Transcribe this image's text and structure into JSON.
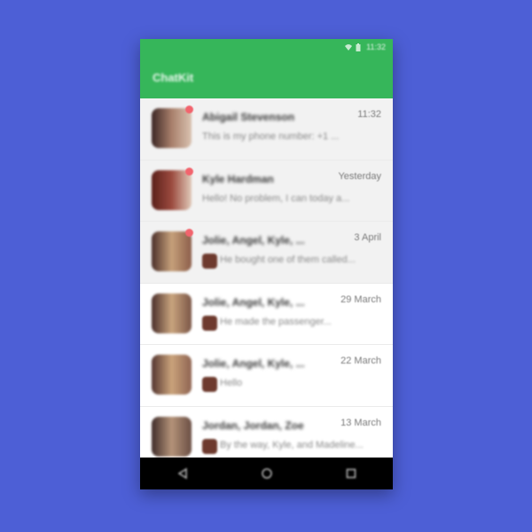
{
  "status_bar": {
    "time": "11:32"
  },
  "app_bar": {
    "title": "ChatKit"
  },
  "conversations": [
    {
      "name": "Abigail Stevenson",
      "time": "11:32",
      "snippet": "This is my phone number: +1 ...",
      "unread": true,
      "has_mini_avatar": false,
      "avatar_colors": [
        "#3b2624",
        "#a87f6b",
        "#d9c2b0"
      ]
    },
    {
      "name": "Kyle Hardman",
      "time": "Yesterday",
      "snippet": "Hello! No problem, I can today a...",
      "unread": true,
      "has_mini_avatar": false,
      "avatar_colors": [
        "#5a1f1a",
        "#9b4a3e",
        "#e0c9b8"
      ]
    },
    {
      "name": "Jolie, Angel, Kyle, ...",
      "time": "3 April",
      "snippet": "He bought one of them called...",
      "unread": true,
      "has_mini_avatar": true,
      "avatar_colors": [
        "#4b2f2a",
        "#c6a07a",
        "#8c5e4a"
      ]
    },
    {
      "name": "Jolie, Angel, Kyle, ...",
      "time": "29 March",
      "snippet": "He made the passenger...",
      "unread": false,
      "has_mini_avatar": true,
      "avatar_colors": [
        "#4a2e2b",
        "#c9a47e",
        "#7b5647"
      ]
    },
    {
      "name": "Jolie, Angel, Kyle, ...",
      "time": "22 March",
      "snippet": "Hello",
      "unread": false,
      "has_mini_avatar": true,
      "avatar_colors": [
        "#543530",
        "#caa37b",
        "#8f6452"
      ]
    },
    {
      "name": "Jordan, Jordan, Zoe",
      "time": "13 March",
      "snippet": "By the way, Kyle, and Madeline...",
      "unread": false,
      "has_mini_avatar": true,
      "avatar_colors": [
        "#3f2c2a",
        "#b49379",
        "#6a4e44"
      ]
    }
  ],
  "colors": {
    "background": "#4d5fd6",
    "app_bar": "#36b65a",
    "unread_badge": "#f2646d",
    "unread_row": "#f2f2f2",
    "nav_bar": "#000000"
  },
  "navigation": {
    "back_icon": "back-triangle-icon",
    "home_icon": "home-circle-icon",
    "recents_icon": "recents-square-icon"
  }
}
